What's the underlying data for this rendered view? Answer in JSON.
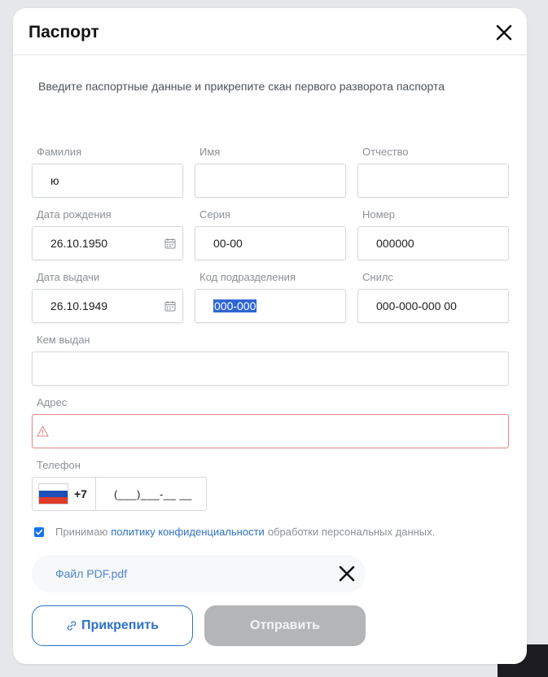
{
  "modal": {
    "title": "Паспорт",
    "instruction": "Введите паспортные данные и прикрепите скан первого разворота паспорта"
  },
  "fields": {
    "surname": {
      "label": "Фамилия",
      "value": "ю"
    },
    "name": {
      "label": "Имя",
      "value": ""
    },
    "patronymic": {
      "label": "Отчество",
      "value": ""
    },
    "birth_date": {
      "label": "Дата рождения",
      "value": "26.10.1950"
    },
    "series": {
      "label": "Серия",
      "value": "00-00"
    },
    "number": {
      "label": "Номер",
      "value": "000000"
    },
    "issue_date": {
      "label": "Дата выдачи",
      "value": "26.10.1949"
    },
    "division_code": {
      "label": "Код подразделения",
      "value": "000-000"
    },
    "snils": {
      "label": "Снилс",
      "value": "000-000-000 00"
    },
    "issued_by": {
      "label": "Кем выдан",
      "value": ""
    },
    "address": {
      "label": "Адрес",
      "value": ""
    },
    "phone": {
      "label": "Телефон",
      "country_code": "+7",
      "mask": "(___)___-__ __"
    }
  },
  "consent": {
    "checked": true,
    "text_before": "Принимаю",
    "link_text": "политику конфиденциальности",
    "text_after": "обработки персональных данных."
  },
  "attachment": {
    "file_name": "Файл PDF.pdf"
  },
  "buttons": {
    "attach_label": "Прикрепить",
    "send_label": "Отправить"
  },
  "colors": {
    "accent": "#2f72c4",
    "error_border": "#e48a8a",
    "disabled_button": "#b4b5b6",
    "selection": "#2f66d0"
  },
  "icons": [
    "close-icon",
    "calendar-icon",
    "warning-icon",
    "russia-flag-icon",
    "link-icon",
    "remove-file-icon"
  ]
}
